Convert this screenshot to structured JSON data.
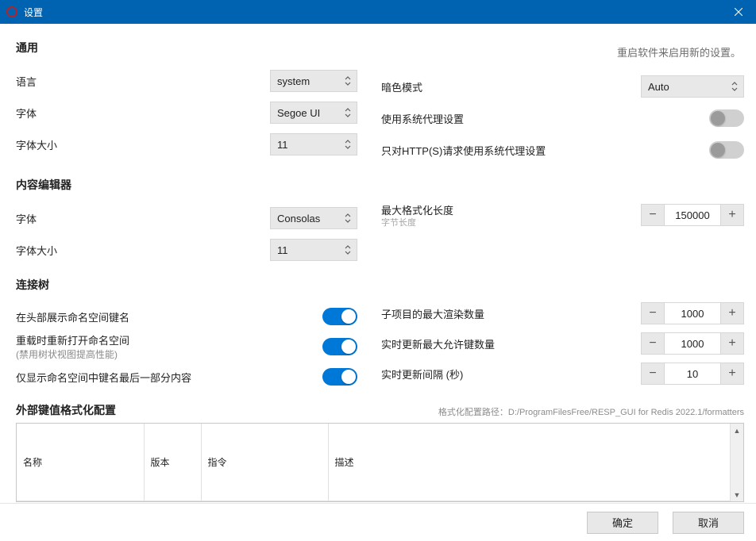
{
  "titlebar": {
    "title": "设置"
  },
  "restart_hint": "重启软件来启用新的设置。",
  "general": {
    "title": "通用",
    "language_label": "语言",
    "language_value": "system",
    "font_label": "字体",
    "font_value": "Segoe UI",
    "font_size_label": "字体大小",
    "font_size_value": "11",
    "dark_mode_label": "暗色模式",
    "dark_mode_value": "Auto",
    "use_system_proxy_label": "使用系统代理设置",
    "use_system_proxy_on": false,
    "http_only_proxy_label": "只对HTTP(S)请求使用系统代理设置",
    "http_only_proxy_on": false
  },
  "editor": {
    "title": "内容编辑器",
    "font_label": "字体",
    "font_value": "Consolas",
    "font_size_label": "字体大小",
    "font_size_value": "11",
    "max_fmt_length_label": "最大格式化长度",
    "max_fmt_length_hint": "字节长度",
    "max_fmt_length_value": "150000"
  },
  "tree": {
    "title": "连接树",
    "show_ns_label": "在头部展示命名空间键名",
    "show_ns_on": true,
    "reopen_ns_label": "重载时重新打开命名空间",
    "reopen_ns_hint": "(禁用树状视图提高性能)",
    "reopen_ns_on": true,
    "show_last_part_label": "仅显示命名空间中键名最后一部分内容",
    "show_last_part_on": true,
    "max_render_label": "子项目的最大渲染数量",
    "max_render_value": "1000",
    "max_keys_label": "实时更新最大允许键数量",
    "max_keys_value": "1000",
    "update_interval_label": "实时更新间隔 (秒)",
    "update_interval_value": "10"
  },
  "formatters": {
    "title": "外部键值格式化配置",
    "path_label": "格式化配置路径：",
    "path_value": "D:/ProgramFilesFree/RESP_GUI for Redis 2022.1/formatters",
    "cols": {
      "name": "名称",
      "version": "版本",
      "command": "指令",
      "desc": "描述"
    }
  },
  "footer": {
    "ok": "确定",
    "cancel": "取消"
  }
}
